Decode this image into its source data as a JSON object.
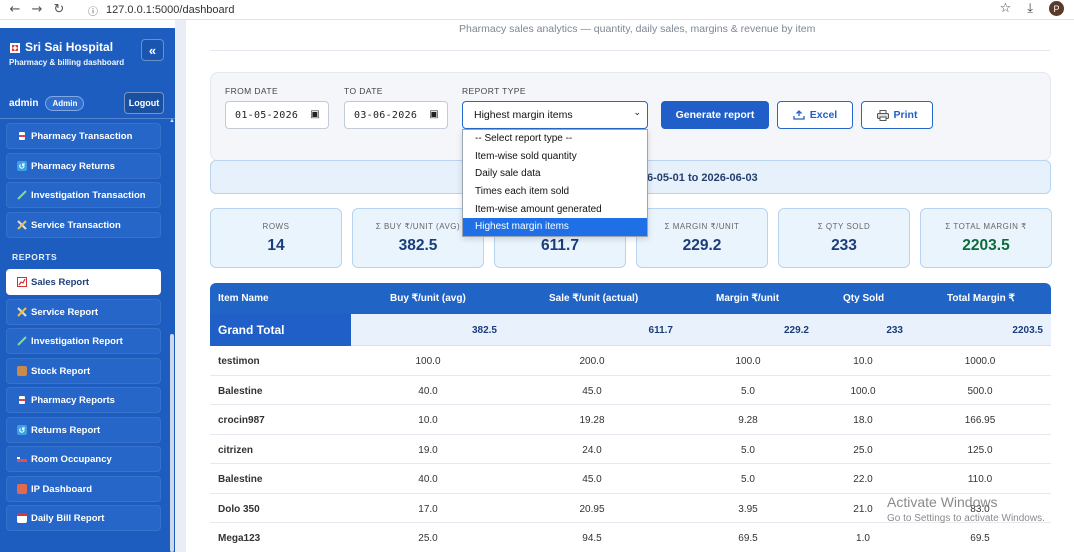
{
  "browser": {
    "url": "127.0.0.1:5000/dashboard",
    "profile_initial": "P"
  },
  "sidebar": {
    "brand_title": "Sri Sai Hospital",
    "brand_subtitle": "Pharmacy & billing dashboard",
    "collapse_label": "«",
    "user": "admin",
    "role": "Admin",
    "logout": "Logout",
    "reports_heading": "REPORTS",
    "items_top": [
      {
        "label": "Pharmacy Transaction",
        "icon": "pill-icon"
      },
      {
        "label": "Pharmacy Returns",
        "icon": "returns-icon"
      },
      {
        "label": "Investigation Transaction",
        "icon": "syringe-icon"
      },
      {
        "label": "Service Transaction",
        "icon": "tools-icon"
      }
    ],
    "items_reports": [
      {
        "label": "Sales Report",
        "icon": "chart-icon",
        "active": true
      },
      {
        "label": "Service Report",
        "icon": "tools-icon"
      },
      {
        "label": "Investigation Report",
        "icon": "syringe-icon"
      },
      {
        "label": "Stock Report",
        "icon": "box-icon"
      },
      {
        "label": "Pharmacy Reports",
        "icon": "pill-icon"
      },
      {
        "label": "Returns Report",
        "icon": "returns-icon"
      },
      {
        "label": "Room Occupancy",
        "icon": "bed-icon"
      },
      {
        "label": "IP Dashboard",
        "icon": "dashboard-icon"
      },
      {
        "label": "Daily Bill Report",
        "icon": "calendar-icon"
      }
    ]
  },
  "header": {
    "subtitle": "Pharmacy sales analytics — quantity, daily sales, margins & revenue by item"
  },
  "filters": {
    "from_label": "FROM DATE",
    "from_value": "01-05-2026",
    "to_label": "TO DATE",
    "to_value": "03-06-2026",
    "type_label": "REPORT TYPE",
    "type_value": "Highest margin items",
    "generate": "Generate report",
    "excel": "Excel",
    "print": "Print",
    "options": [
      "-- Select report type --",
      "Item-wise sold quantity",
      "Daily sale data",
      "Times each item sold",
      "Item-wise amount generated",
      "Highest margin items"
    ]
  },
  "range_text": "6-05-01 to 2026-06-03",
  "stats": [
    {
      "label": "ROWS",
      "value": "14"
    },
    {
      "label": "Σ BUY ₹/UNIT (AVG)",
      "value": "382.5"
    },
    {
      "label": "",
      "value": "611.7"
    },
    {
      "label": "Σ MARGIN ₹/UNIT",
      "value": "229.2"
    },
    {
      "label": "Σ QTY SOLD",
      "value": "233"
    },
    {
      "label": "Σ TOTAL MARGIN ₹",
      "value": "2203.5"
    }
  ],
  "table": {
    "headers": [
      "Item Name",
      "Buy ₹/unit (avg)",
      "Sale ₹/unit (actual)",
      "Margin ₹/unit",
      "Qty Sold",
      "Total Margin ₹"
    ],
    "grand_total": {
      "label": "Grand Total",
      "buy": "382.5",
      "sale": "611.7",
      "margin": "229.2",
      "qty": "233",
      "total": "2203.5"
    },
    "rows": [
      [
        "testimon",
        "100.0",
        "200.0",
        "100.0",
        "10.0",
        "1000.0"
      ],
      [
        "Balestine",
        "40.0",
        "45.0",
        "5.0",
        "100.0",
        "500.0"
      ],
      [
        "crocin987",
        "10.0",
        "19.28",
        "9.28",
        "18.0",
        "166.95"
      ],
      [
        "citrizen",
        "19.0",
        "24.0",
        "5.0",
        "25.0",
        "125.0"
      ],
      [
        "Balestine",
        "40.0",
        "45.0",
        "5.0",
        "22.0",
        "110.0"
      ],
      [
        "Dolo 350",
        "17.0",
        "20.95",
        "3.95",
        "21.0",
        "83.0"
      ],
      [
        "Mega123",
        "25.0",
        "94.5",
        "69.5",
        "1.0",
        "69.5"
      ]
    ]
  },
  "watermark": {
    "line1": "Activate Windows",
    "line2": "Go to Settings to activate Windows."
  },
  "colors": {
    "sidebar": "#1d5dbf",
    "accent": "#1f5fc7",
    "header": "#2064c5",
    "positive": "#0e6b3a"
  }
}
